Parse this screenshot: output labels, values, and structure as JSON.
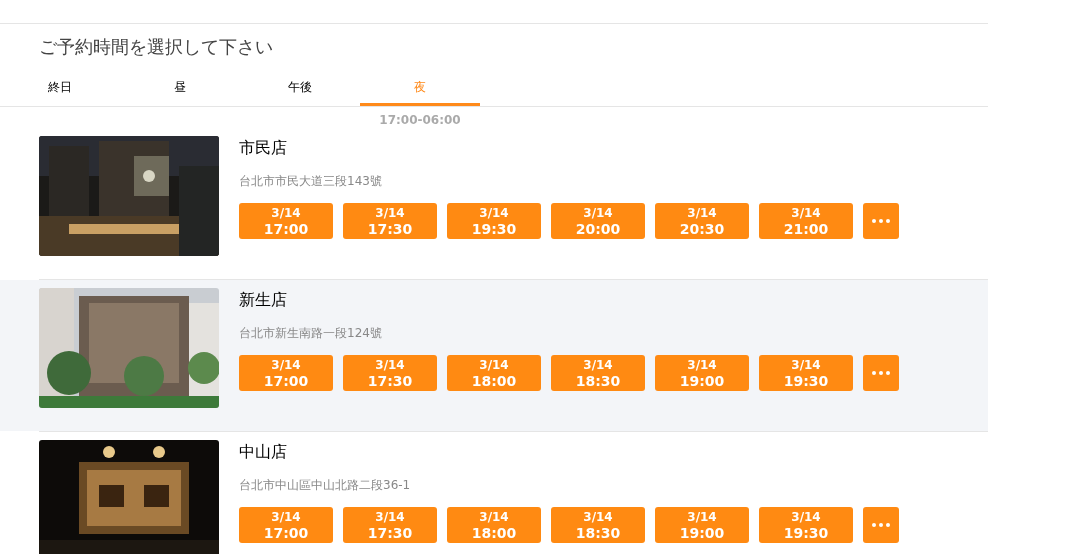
{
  "title": "ご予約時間を選択して下さい",
  "tabs": [
    {
      "label": "終日",
      "selected": false
    },
    {
      "label": "昼",
      "selected": false
    },
    {
      "label": "午後",
      "selected": false
    },
    {
      "label": "夜",
      "selected": true
    }
  ],
  "time_range": "17:00-06:00",
  "stores": [
    {
      "name": "市民店",
      "address": "台北市市民大道三段143號",
      "highlighted": false,
      "slots": [
        {
          "date": "3/14",
          "time": "17:00"
        },
        {
          "date": "3/14",
          "time": "17:30"
        },
        {
          "date": "3/14",
          "time": "19:30"
        },
        {
          "date": "3/14",
          "time": "20:00"
        },
        {
          "date": "3/14",
          "time": "20:30"
        },
        {
          "date": "3/14",
          "time": "21:00"
        }
      ]
    },
    {
      "name": "新生店",
      "address": "台北市新生南路一段124號",
      "highlighted": true,
      "slots": [
        {
          "date": "3/14",
          "time": "17:00"
        },
        {
          "date": "3/14",
          "time": "17:30"
        },
        {
          "date": "3/14",
          "time": "18:00"
        },
        {
          "date": "3/14",
          "time": "18:30"
        },
        {
          "date": "3/14",
          "time": "19:00"
        },
        {
          "date": "3/14",
          "time": "19:30"
        }
      ]
    },
    {
      "name": "中山店",
      "address": "台北市中山區中山北路二段36-1",
      "highlighted": false,
      "slots": [
        {
          "date": "3/14",
          "time": "17:00"
        },
        {
          "date": "3/14",
          "time": "17:30"
        },
        {
          "date": "3/14",
          "time": "18:00"
        },
        {
          "date": "3/14",
          "time": "18:30"
        },
        {
          "date": "3/14",
          "time": "19:00"
        },
        {
          "date": "3/14",
          "time": "19:30"
        }
      ]
    }
  ]
}
